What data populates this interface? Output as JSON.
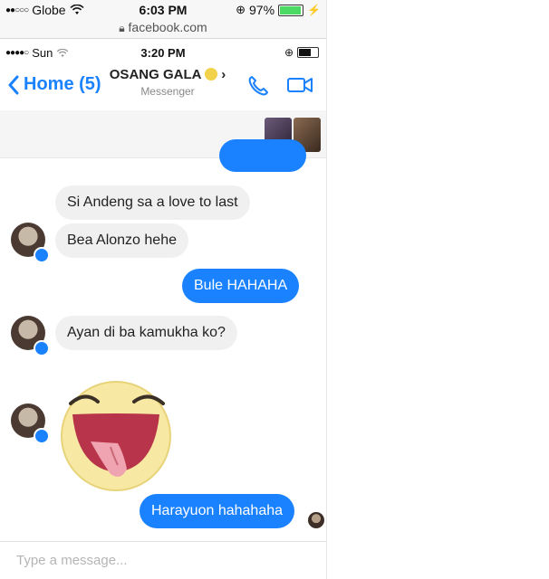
{
  "outer_status": {
    "carrier": "Globe",
    "time": "6:03 PM",
    "battery": "97%",
    "battery_level": 0.97
  },
  "browser": {
    "url": "facebook.com"
  },
  "inner_status": {
    "carrier": "Sun",
    "time": "3:20 PM"
  },
  "nav": {
    "back_label": "Home (5)",
    "contact_name": "OSANG GALA",
    "subtitle": "Messenger"
  },
  "messages": [
    {
      "text": "Si Andeng sa a love to last",
      "direction": "incoming"
    },
    {
      "text": "Bea Alonzo hehe",
      "direction": "incoming"
    },
    {
      "text": "Bule HAHAHA",
      "direction": "outgoing"
    },
    {
      "text": "Ayan di ba kamukha ko?",
      "direction": "incoming"
    },
    {
      "text": "Harayuon hahahaha",
      "direction": "outgoing"
    }
  ],
  "composer": {
    "placeholder": "Type a message..."
  },
  "colors": {
    "accent": "#1a82ff",
    "incoming_bubble": "#f1f0f0",
    "battery": "#4cd964"
  },
  "icons": [
    "wifi-icon",
    "lock-icon",
    "battery-icon",
    "back-chevron-icon",
    "phone-icon",
    "video-camera-icon",
    "messenger-badge-icon",
    "emoji-sticker-icon"
  ]
}
